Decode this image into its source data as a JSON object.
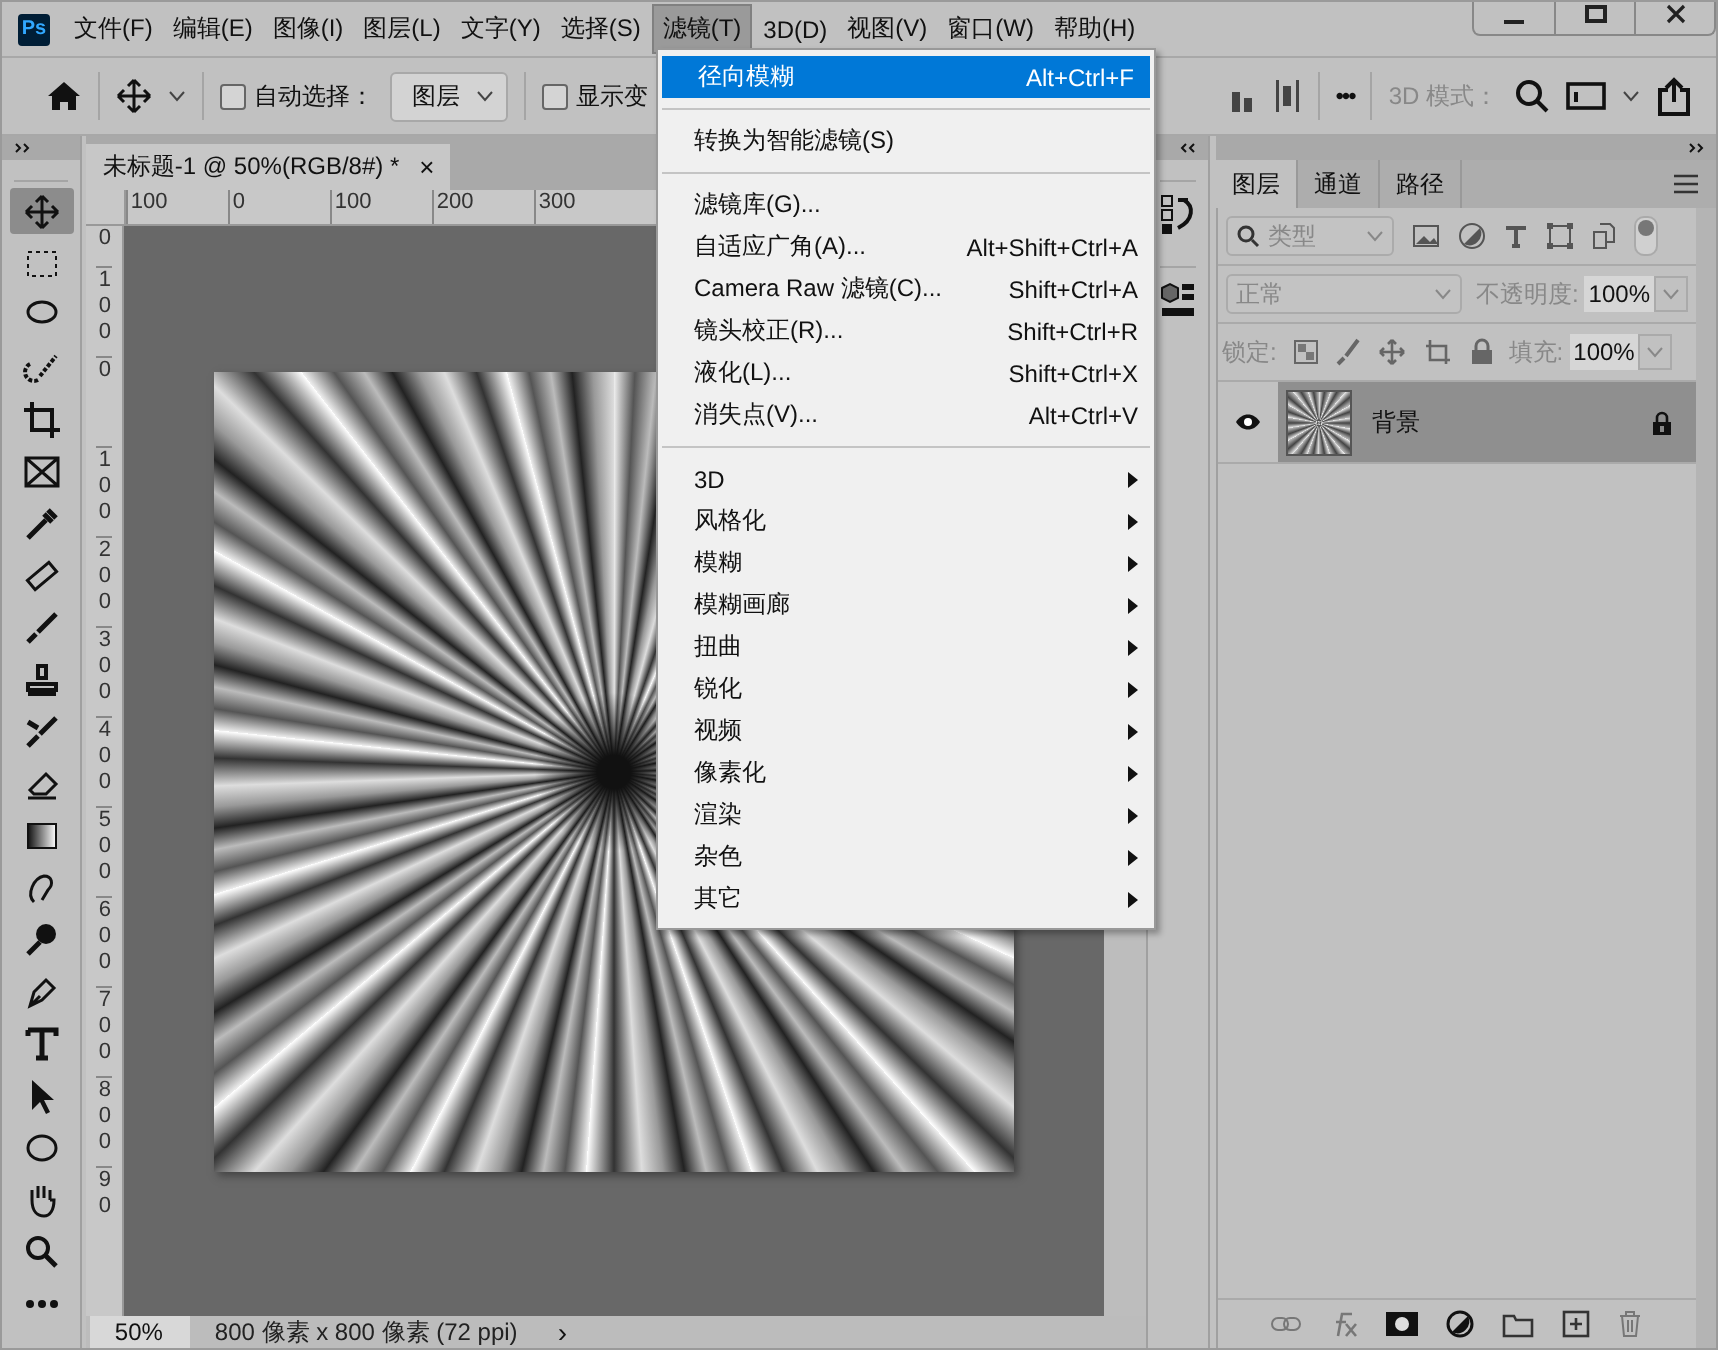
{
  "app": {
    "logo": "Ps"
  },
  "menu_bar": [
    {
      "label": "文件(F)",
      "selected": false
    },
    {
      "label": "编辑(E)",
      "selected": false
    },
    {
      "label": "图像(I)",
      "selected": false
    },
    {
      "label": "图层(L)",
      "selected": false
    },
    {
      "label": "文字(Y)",
      "selected": false
    },
    {
      "label": "选择(S)",
      "selected": false
    },
    {
      "label": "滤镜(T)",
      "selected": true
    },
    {
      "label": "3D(D)",
      "selected": false
    },
    {
      "label": "视图(V)",
      "selected": false
    },
    {
      "label": "窗口(W)",
      "selected": false
    },
    {
      "label": "帮助(H)",
      "selected": false
    }
  ],
  "options_bar": {
    "auto_select": {
      "label": "自动选择：",
      "checked": false
    },
    "layer_dropdown": "图层",
    "show_transform": {
      "label": "显示变",
      "checked": false
    },
    "more": "•••",
    "mode_3d": "3D 模式："
  },
  "document_tab": {
    "title": "未标题-1 @ 50%(RGB/8#) *",
    "close": "×"
  },
  "rulers": {
    "horizontal": [
      "100",
      "0",
      "100",
      "200",
      "300"
    ],
    "vertical": [
      "0",
      "100",
      "0",
      "100",
      "200",
      "300",
      "400",
      "500",
      "600",
      "700",
      "800",
      "90"
    ]
  },
  "status_bar": {
    "zoom": "50%",
    "info": "800 像素 x 800 像素 (72 ppi)",
    "arrow": "›"
  },
  "layers_panel": {
    "tabs": [
      {
        "label": "图层",
        "selected": true
      },
      {
        "label": "通道",
        "selected": false
      },
      {
        "label": "路径",
        "selected": false
      }
    ],
    "filter_placeholder": "类型",
    "blend_mode": "正常",
    "opacity_label": "不透明度:",
    "opacity": "100%",
    "lock_label": "锁定:",
    "fill_label": "填充:",
    "fill": "100%",
    "layers": [
      {
        "name": "背景",
        "visible": true,
        "locked": true,
        "selected": true
      }
    ]
  },
  "filter_menu": [
    {
      "kind": "item",
      "label": "径向模糊",
      "shortcut": "Alt+Ctrl+F",
      "selected": true
    },
    {
      "kind": "separator"
    },
    {
      "kind": "item",
      "label": "转换为智能滤镜(S)",
      "selected": false
    },
    {
      "kind": "separator"
    },
    {
      "kind": "item",
      "label": "滤镜库(G)...",
      "selected": false
    },
    {
      "kind": "item",
      "label": "自适应广角(A)...",
      "shortcut": "Alt+Shift+Ctrl+A",
      "selected": false
    },
    {
      "kind": "item",
      "label": "Camera Raw 滤镜(C)...",
      "shortcut": "Shift+Ctrl+A",
      "selected": false
    },
    {
      "kind": "item",
      "label": "镜头校正(R)...",
      "shortcut": "Shift+Ctrl+R",
      "selected": false
    },
    {
      "kind": "item",
      "label": "液化(L)...",
      "shortcut": "Shift+Ctrl+X",
      "selected": false
    },
    {
      "kind": "item",
      "label": "消失点(V)...",
      "shortcut": "Alt+Ctrl+V",
      "selected": false
    },
    {
      "kind": "separator"
    },
    {
      "kind": "submenu",
      "label": "3D",
      "selected": false
    },
    {
      "kind": "submenu",
      "label": "风格化",
      "selected": false
    },
    {
      "kind": "submenu",
      "label": "模糊",
      "selected": false
    },
    {
      "kind": "submenu",
      "label": "模糊画廊",
      "selected": false
    },
    {
      "kind": "submenu",
      "label": "扭曲",
      "selected": false
    },
    {
      "kind": "submenu",
      "label": "锐化",
      "selected": false
    },
    {
      "kind": "submenu",
      "label": "视频",
      "selected": false
    },
    {
      "kind": "submenu",
      "label": "像素化",
      "selected": false
    },
    {
      "kind": "submenu",
      "label": "渲染",
      "selected": false
    },
    {
      "kind": "submenu",
      "label": "杂色",
      "selected": false
    },
    {
      "kind": "submenu",
      "label": "其它",
      "selected": false
    }
  ]
}
